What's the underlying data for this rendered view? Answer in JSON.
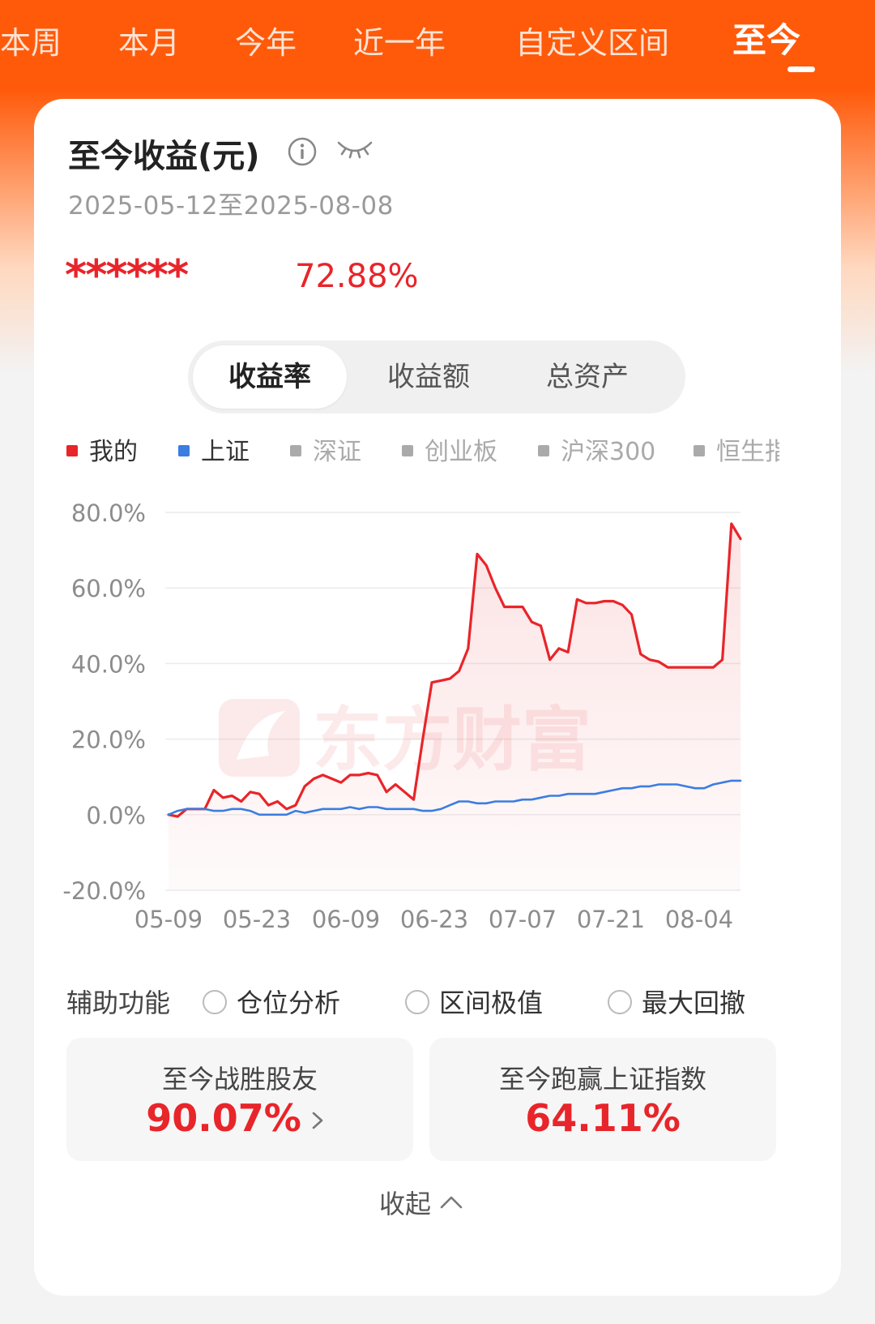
{
  "tabs": [
    {
      "label": "本周"
    },
    {
      "label": "本月"
    },
    {
      "label": "今年"
    },
    {
      "label": "近一年"
    },
    {
      "label": "自定义区间"
    },
    {
      "label": "至今",
      "active": true
    }
  ],
  "card": {
    "title": "至今收益(元)",
    "info_icon": "info-icon",
    "visibility_icon": "eye-closed-icon",
    "date_range": "2025-05-12至2025-08-08",
    "hidden_amount": "******",
    "return_pct": "72.88%"
  },
  "segment": {
    "options": [
      "收益率",
      "收益额",
      "总资产"
    ],
    "selected": "收益率"
  },
  "legend": [
    {
      "label": "我的",
      "color": "#e8252a",
      "active": true
    },
    {
      "label": "上证",
      "color": "#3b7de0",
      "active": true
    },
    {
      "label": "深证",
      "color": "#aaaaaa",
      "active": false
    },
    {
      "label": "创业板",
      "color": "#aaaaaa",
      "active": false
    },
    {
      "label": "沪深300",
      "color": "#aaaaaa",
      "active": false
    },
    {
      "label": "恒生指",
      "color": "#aaaaaa",
      "active": false
    }
  ],
  "watermark": "东方财富",
  "chart_data": {
    "type": "line",
    "ylim": [
      -20,
      80
    ],
    "y_ticks": [
      "80.0%",
      "60.0%",
      "40.0%",
      "20.0%",
      "0.0%",
      "-20.0%"
    ],
    "y_tick_values": [
      80,
      60,
      40,
      20,
      0,
      -20
    ],
    "x_ticks": [
      "05-09",
      "05-23",
      "06-09",
      "06-23",
      "07-07",
      "07-21",
      "08-04"
    ],
    "grid": true,
    "series": [
      {
        "name": "我的",
        "color": "#e8252a",
        "fill": true,
        "values": [
          0,
          -0.5,
          1.5,
          1.5,
          1.5,
          6.5,
          4.5,
          5,
          3.5,
          6,
          5.5,
          2.5,
          3.5,
          1.5,
          2.5,
          7.5,
          9.5,
          10.5,
          9.5,
          8.5,
          10.5,
          10.5,
          11,
          10.5,
          6,
          8,
          6,
          4,
          20,
          35,
          35.5,
          36,
          38,
          44,
          69,
          66,
          60,
          55,
          55,
          55,
          51,
          50,
          41,
          44,
          43,
          57,
          56,
          56,
          56.5,
          56.5,
          55.5,
          53,
          42.5,
          41,
          40.5,
          39,
          39,
          39,
          39,
          39,
          39,
          41,
          77,
          73
        ]
      },
      {
        "name": "上证",
        "color": "#3b7de0",
        "fill": false,
        "values": [
          0,
          1,
          1.5,
          1.5,
          1.5,
          1,
          1,
          1.5,
          1.5,
          1,
          0,
          0,
          0,
          0,
          1,
          0.5,
          1,
          1.5,
          1.5,
          1.5,
          2,
          1.5,
          2,
          2,
          1.5,
          1.5,
          1.5,
          1.5,
          1,
          1,
          1.5,
          2.5,
          3.5,
          3.5,
          3,
          3,
          3.5,
          3.5,
          3.5,
          4,
          4,
          4.5,
          5,
          5,
          5.5,
          5.5,
          5.5,
          5.5,
          6,
          6.5,
          7,
          7,
          7.5,
          7.5,
          8,
          8,
          8,
          7.5,
          7,
          7,
          8,
          8.5,
          9,
          9
        ]
      }
    ]
  },
  "aux": {
    "label": "辅助功能",
    "options": [
      "仓位分析",
      "区间极值",
      "最大回撤"
    ]
  },
  "stats": [
    {
      "label": "至今战胜股友",
      "value": "90.07%",
      "has_arrow": true
    },
    {
      "label": "至今跑赢上证指数",
      "value": "64.11%",
      "has_arrow": false
    }
  ],
  "collapse_label": "收起"
}
